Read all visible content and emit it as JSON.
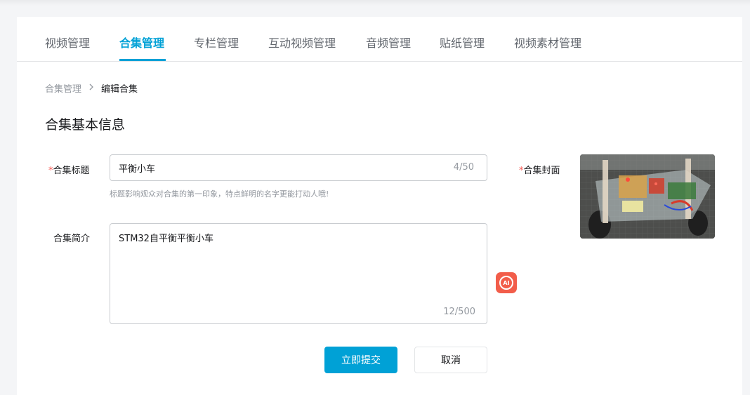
{
  "tabs": [
    {
      "label": "视频管理",
      "active": false
    },
    {
      "label": "合集管理",
      "active": true
    },
    {
      "label": "专栏管理",
      "active": false
    },
    {
      "label": "互动视频管理",
      "active": false
    },
    {
      "label": "音频管理",
      "active": false
    },
    {
      "label": "贴纸管理",
      "active": false
    },
    {
      "label": "视频素材管理",
      "active": false
    }
  ],
  "breadcrumb": {
    "parent": "合集管理",
    "separator": ">",
    "current": "编辑合集"
  },
  "section_title": "合集基本信息",
  "form": {
    "title_field": {
      "required_mark": "*",
      "label": "合集标题",
      "value": "平衡小车",
      "counter": "4/50",
      "hint": "标题影响观众对合集的第一印象，特点鲜明的名字更能打动人哦!"
    },
    "intro_field": {
      "label": "合集简介",
      "value": "STM32自平衡平衡小车",
      "counter": "12/500"
    },
    "cover_field": {
      "required_mark": "*",
      "label": "合集封面"
    },
    "ai_button_text": "AI"
  },
  "actions": {
    "submit_label": "立即提交",
    "cancel_label": "取消"
  },
  "colors": {
    "accent": "#00a1d6",
    "required": "#f85a54",
    "ai_button": "#f25d4a"
  }
}
